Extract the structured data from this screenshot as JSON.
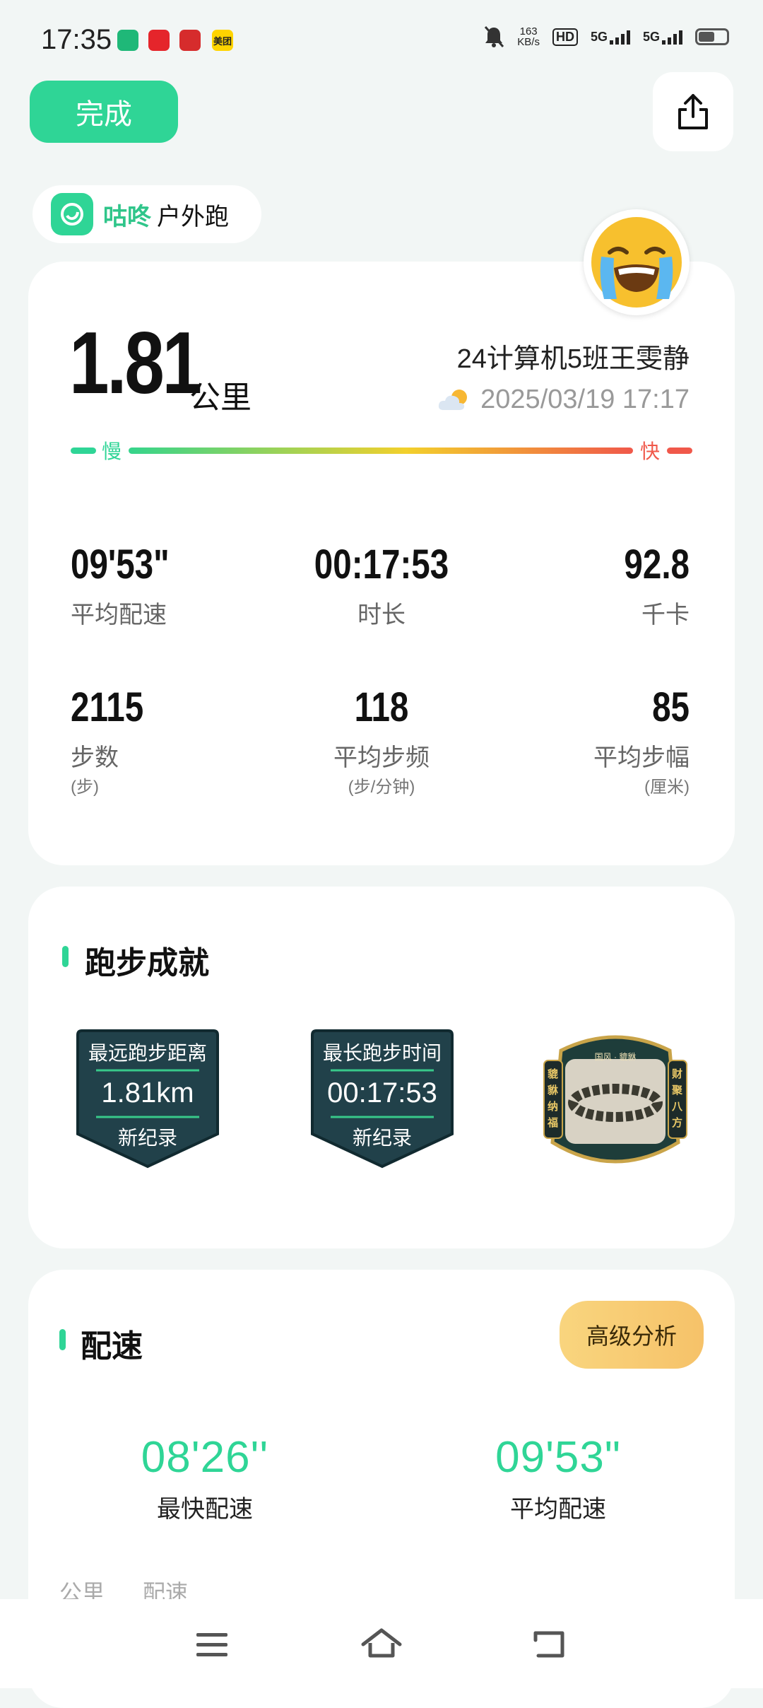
{
  "status_bar": {
    "time": "17:35",
    "net_speed_value": "163",
    "net_speed_unit": "KB/s",
    "hd_label": "HD",
    "signal1": "5G",
    "signal2": "5G",
    "app_icons": [
      "green-app-icon",
      "red-app-icon",
      "red-app-icon-2",
      "meituan-icon"
    ],
    "meituan": "美团"
  },
  "header": {
    "done_label": "完成",
    "share_icon": "share-icon"
  },
  "brand": {
    "name": "咕咚",
    "mode": "户外跑"
  },
  "summary": {
    "distance": "1.81",
    "distance_unit": "公里",
    "user_name": "24计算机5班王雯静",
    "datetime": "2025/03/19 17:17",
    "weather_icon": "partly-cloudy-icon",
    "slow_label": "慢",
    "fast_label": "快",
    "metrics": [
      {
        "value": "09'53\"",
        "label": "平均配速",
        "sub": ""
      },
      {
        "value": "00:17:53",
        "label": "时长",
        "sub": ""
      },
      {
        "value": "92.8",
        "label": "千卡",
        "sub": ""
      },
      {
        "value": "2115",
        "label": "步数",
        "sub": "(步)"
      },
      {
        "value": "118",
        "label": "平均步频",
        "sub": "(步/分钟)"
      },
      {
        "value": "85",
        "label": "平均步幅",
        "sub": "(厘米)"
      }
    ]
  },
  "achievements": {
    "title": "跑步成就",
    "badges": [
      {
        "title": "最远跑步距离",
        "value": "1.81km",
        "footer": "新纪录"
      },
      {
        "title": "最长跑步时间",
        "value": "00:17:53",
        "footer": "新纪录"
      },
      {
        "top": "国风 · 貔貅",
        "left": "貔貅纳福",
        "right": "财聚八方"
      }
    ]
  },
  "pace": {
    "title": "配速",
    "advanced_label": "高级分析",
    "fastest_value": "08'26''",
    "fastest_label": "最快配速",
    "average_value": "09'53\"",
    "average_label": "平均配速",
    "col_km": "公里",
    "col_pace": "配速"
  },
  "colors": {
    "accent": "#2fd596",
    "slow": "#2fd596",
    "fast": "#f0584a"
  }
}
